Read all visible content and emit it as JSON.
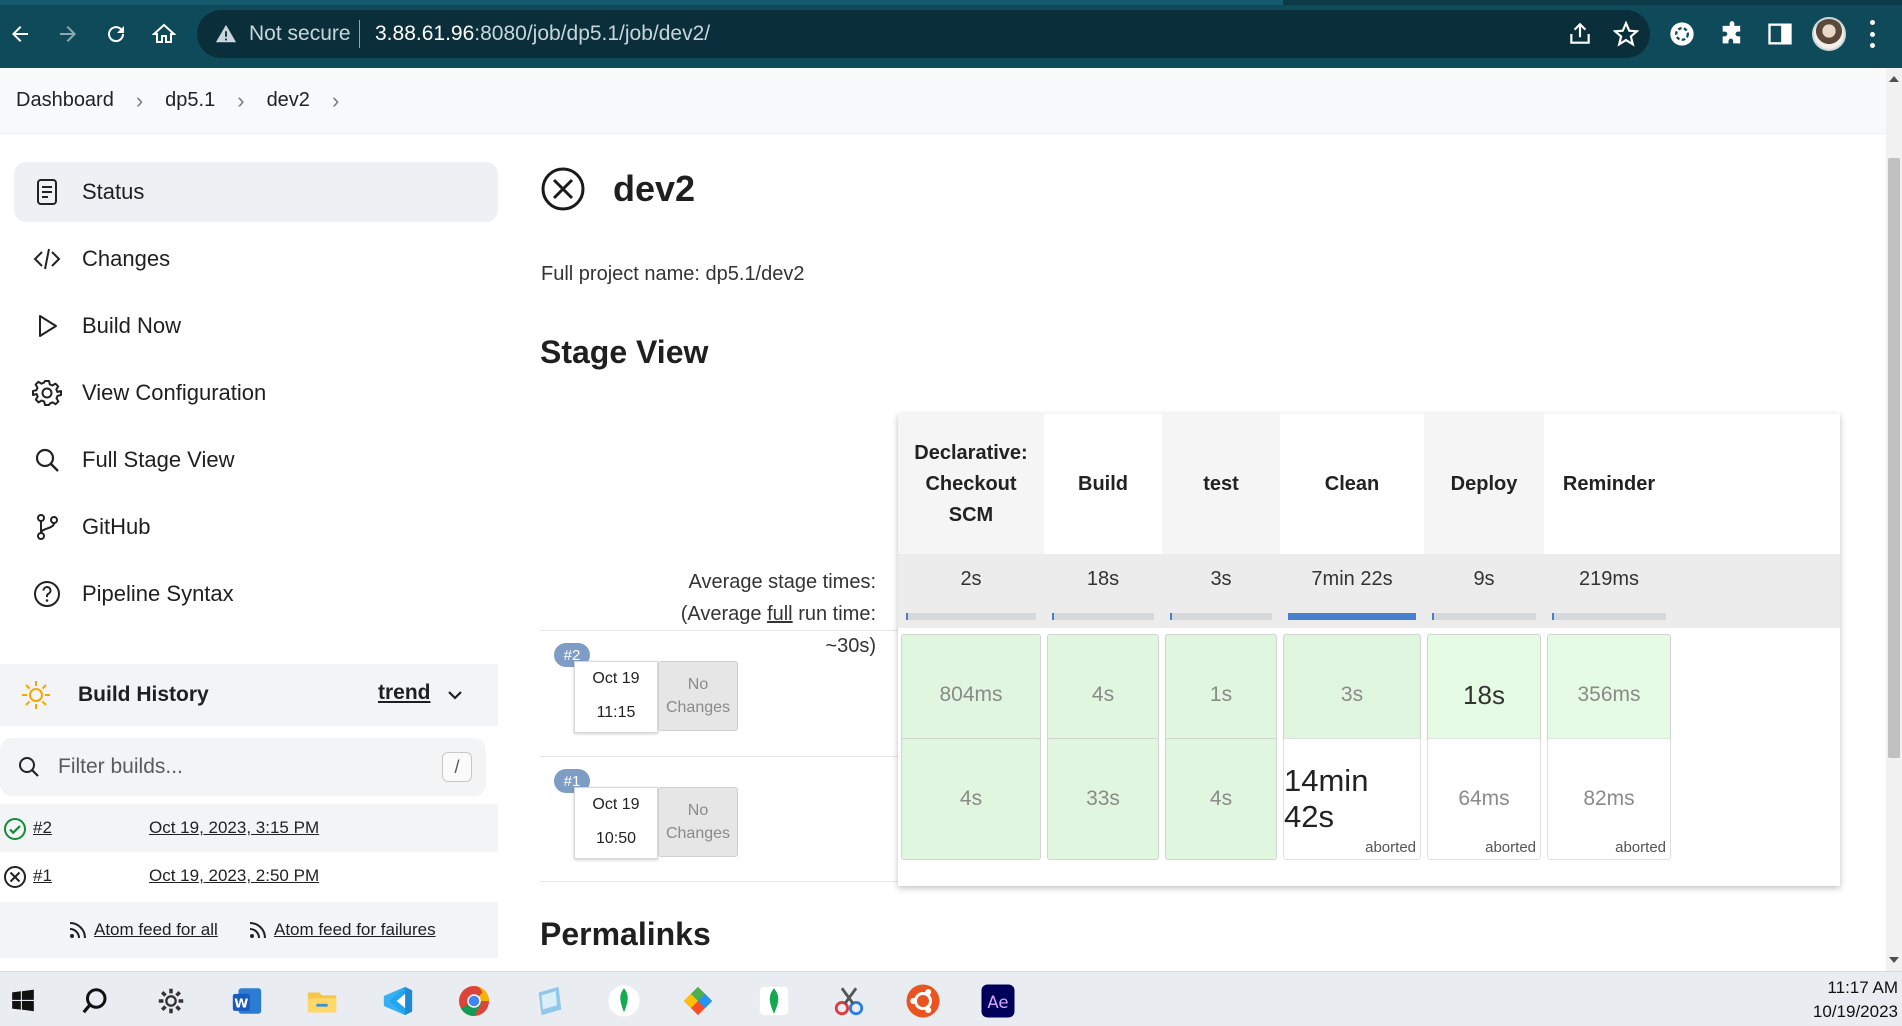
{
  "browser": {
    "security_label": "Not secure",
    "url_host": "3.88.61.96",
    "url_rest": ":8080/job/dp5.1/job/dev2/"
  },
  "breadcrumb": [
    "Dashboard",
    "dp5.1",
    "dev2"
  ],
  "sidebar": {
    "items": [
      {
        "label": "Status",
        "icon": "status-document-icon"
      },
      {
        "label": "Changes",
        "icon": "code-brackets-icon"
      },
      {
        "label": "Build Now",
        "icon": "play-triangle-icon"
      },
      {
        "label": "View Configuration",
        "icon": "gear-icon"
      },
      {
        "label": "Full Stage View",
        "icon": "search-icon"
      },
      {
        "label": "GitHub",
        "icon": "git-branch-icon"
      },
      {
        "label": "Pipeline Syntax",
        "icon": "help-circle-icon"
      }
    ]
  },
  "build_history": {
    "title": "Build History",
    "trend_label": "trend",
    "filter_placeholder": "Filter builds...",
    "filter_shortcut": "/",
    "builds": [
      {
        "number": "#2",
        "date": "Oct 19, 2023, 3:15 PM",
        "status": "success"
      },
      {
        "number": "#1",
        "date": "Oct 19, 2023, 2:50 PM",
        "status": "failed"
      }
    ],
    "feed_all": "Atom feed for all",
    "feed_failures": "Atom feed for failures"
  },
  "job": {
    "title": "dev2",
    "full_name_label": "Full project name: dp5.1/dev2"
  },
  "stage_view": {
    "heading": "Stage View",
    "avg_label_line1": "Average stage times:",
    "avg_label_prefix": "(Average ",
    "avg_label_link": "full",
    "avg_label_suffix": " run time: ~30s)",
    "stages": [
      "Declarative: Checkout SCM",
      "Build",
      "test",
      "Clean",
      "Deploy",
      "Reminder"
    ],
    "stage_lines": [
      [
        "Declarative:",
        "Checkout",
        "SCM"
      ],
      [
        "Build"
      ],
      [
        "test"
      ],
      [
        "Clean"
      ],
      [
        "Deploy"
      ],
      [
        "Reminder"
      ]
    ],
    "averages": [
      "2s",
      "18s",
      "3s",
      "7min 22s",
      "9s",
      "219ms"
    ],
    "avg_fill_fraction": [
      0.0,
      0.0,
      0.0,
      1.0,
      0.0,
      0.0
    ],
    "runs": [
      {
        "badge": "#2",
        "date": "Oct 19",
        "time": "11:15",
        "changes": [
          "No",
          "Changes"
        ],
        "cells": [
          {
            "value": "804ms",
            "status": "success"
          },
          {
            "value": "4s",
            "status": "success"
          },
          {
            "value": "1s",
            "status": "success"
          },
          {
            "value": "3s",
            "status": "success"
          },
          {
            "value": "18s",
            "status": "success"
          },
          {
            "value": "356ms",
            "status": "success"
          }
        ]
      },
      {
        "badge": "#1",
        "date": "Oct 19",
        "time": "10:50",
        "changes": [
          "No",
          "Changes"
        ],
        "cells": [
          {
            "value": "4s",
            "status": "success"
          },
          {
            "value": "33s",
            "status": "success"
          },
          {
            "value": "4s",
            "status": "success"
          },
          {
            "value": "14min 42s",
            "status": "aborted",
            "note": "aborted"
          },
          {
            "value": "64ms",
            "status": "aborted",
            "note": "aborted"
          },
          {
            "value": "82ms",
            "status": "aborted",
            "note": "aborted"
          }
        ]
      }
    ]
  },
  "permalinks": {
    "heading": "Permalinks"
  },
  "taskbar": {
    "time": "11:17 AM",
    "date": "10/19/2023"
  }
}
